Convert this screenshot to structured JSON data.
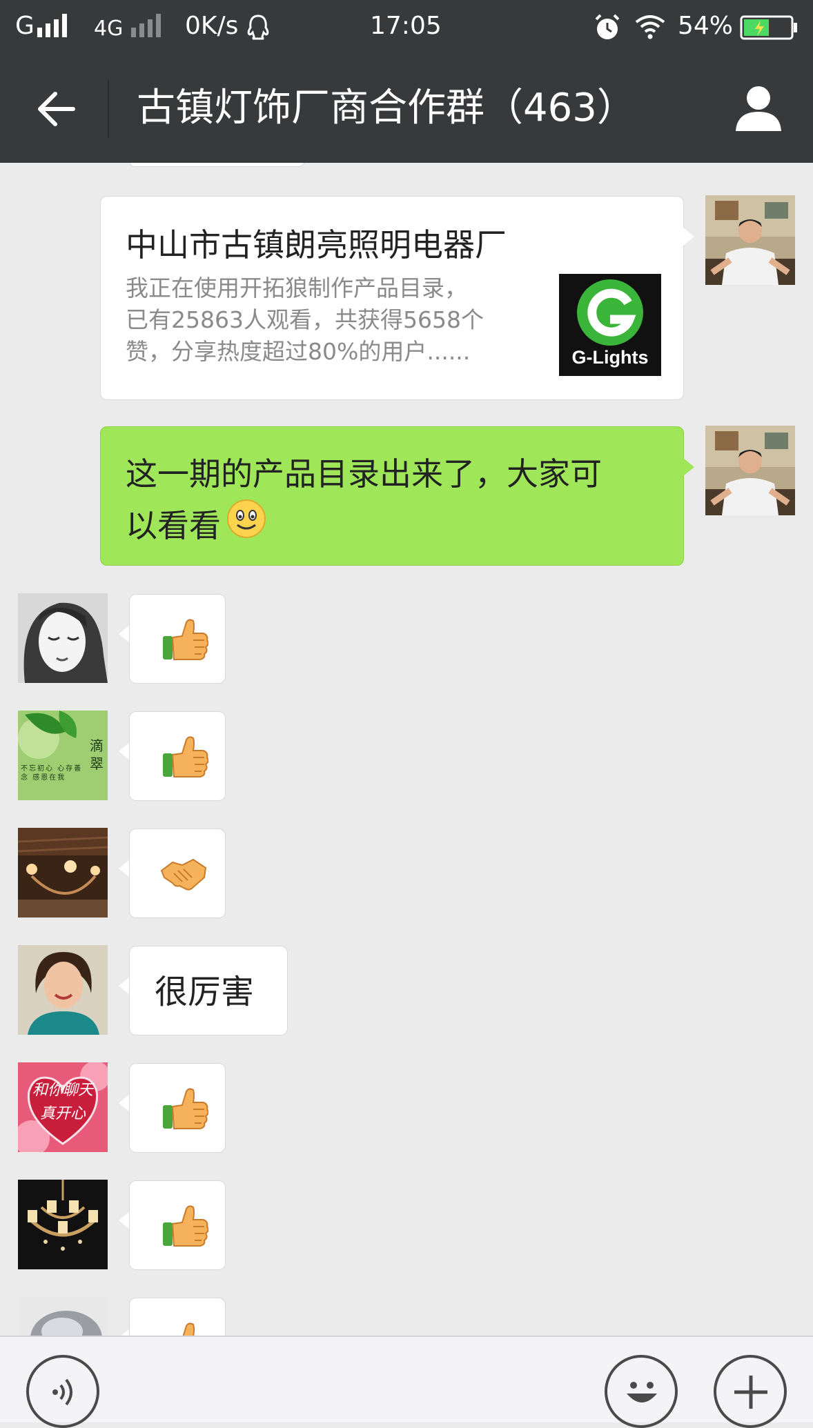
{
  "status_bar": {
    "carrier1": "G",
    "network": "4G",
    "speed": "0K/s",
    "time": "17:05",
    "battery": "54%",
    "battery_level": 0.54,
    "icons": [
      "qq-icon",
      "alarm-icon",
      "wifi-icon",
      "battery-icon"
    ]
  },
  "header": {
    "title": "古镇灯饰厂商合作群（463）",
    "back_icon": "back-arrow-icon",
    "profile_icon": "group-info-icon"
  },
  "messages": [
    {
      "type": "link_card",
      "direction": "outgoing",
      "card_title": "中山市古镇朗亮照明电器厂",
      "card_desc_lines": [
        "我正在使用开拓狼制作产品目录，",
        "已有25863人观看，共获得5658个",
        "赞，分享热度超过80%的用户......"
      ],
      "logo_text": "G-Lights"
    },
    {
      "type": "text",
      "direction": "outgoing",
      "lines": [
        "这一期的产品目录出来了，大家可",
        "以看看"
      ],
      "emoji": "smile-emoji"
    },
    {
      "type": "emoji",
      "direction": "incoming",
      "emoji": "thumbs-up-emoji"
    },
    {
      "type": "emoji",
      "direction": "incoming",
      "emoji": "thumbs-up-emoji"
    },
    {
      "type": "emoji",
      "direction": "incoming",
      "emoji": "handshake-emoji"
    },
    {
      "type": "text",
      "direction": "incoming",
      "text": "很厉害"
    },
    {
      "type": "emoji",
      "direction": "incoming",
      "emoji": "thumbs-up-emoji",
      "avatar_text": [
        "和你聊天",
        "真开心"
      ]
    },
    {
      "type": "emoji",
      "direction": "incoming",
      "emoji": "thumbs-up-emoji"
    },
    {
      "type": "emoji",
      "direction": "incoming",
      "emoji": "thumbs-up-emoji"
    }
  ],
  "avatar_texts": {
    "drip_title": "滴翠",
    "drip_body": "不忘初心 心存善念 感恩在我"
  },
  "input_bar": {
    "voice_icon": "voice-icon",
    "emoji_icon": "emoji-face-icon",
    "add_icon": "plus-icon"
  },
  "colors": {
    "header_bg": "#38393b",
    "chat_bg": "#ebebeb",
    "outgoing_bubble": "#9fe658",
    "incoming_bubble": "#ffffff",
    "logo_green": "#3ab53a"
  }
}
